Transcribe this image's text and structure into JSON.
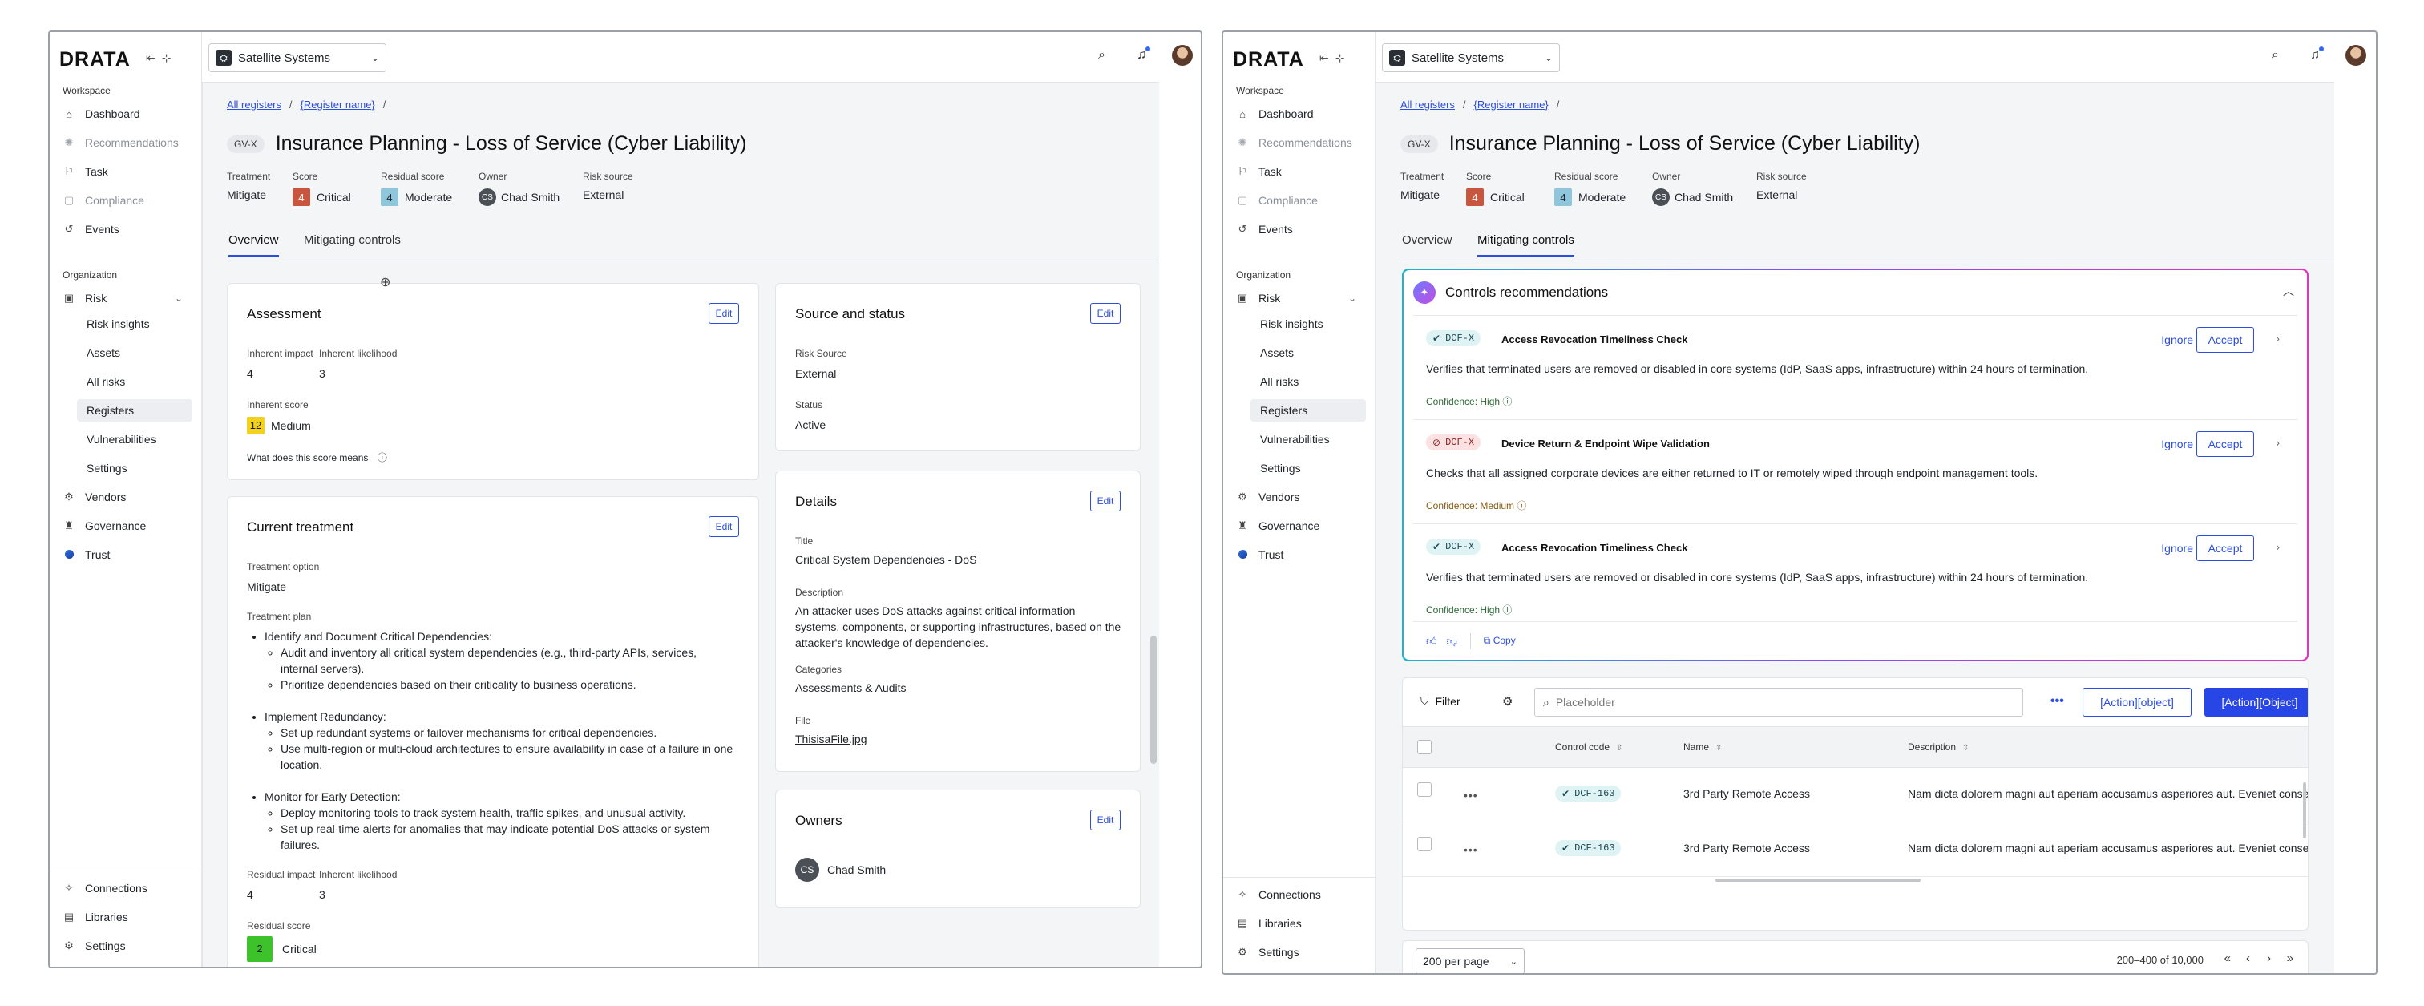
{
  "brand": {
    "logo": "DRATA"
  },
  "org": {
    "name": "Satellite Systems"
  },
  "sidebar": {
    "workspace_label": "Workspace",
    "organization_label": "Organization",
    "items": [
      {
        "label": "Dashboard",
        "icon": "home-icon"
      },
      {
        "label": "Recommendations",
        "icon": "sparkle-icon"
      },
      {
        "label": "Task",
        "icon": "flag-icon"
      },
      {
        "label": "Compliance",
        "icon": "shield-check-icon"
      },
      {
        "label": "Events",
        "icon": "history-icon"
      }
    ],
    "risk": {
      "label": "Risk",
      "icon": "risk-icon"
    },
    "risk_sub": [
      "Risk insights",
      "Assets",
      "All risks",
      "Registers",
      "Vulnerabilities",
      "Settings"
    ],
    "org_items": [
      {
        "label": "Vendors",
        "icon": "vendors-icon"
      },
      {
        "label": "Governance",
        "icon": "governance-icon"
      },
      {
        "label": "Trust",
        "icon": "trust-icon"
      }
    ],
    "bottom": [
      {
        "label": "Connections",
        "icon": "plug-icon"
      },
      {
        "label": "Libraries",
        "icon": "book-icon"
      },
      {
        "label": "Settings",
        "icon": "gear-icon"
      }
    ]
  },
  "page": {
    "breadcrumb": {
      "root": "All registers",
      "current": "{Register name}"
    },
    "code": "GV-X",
    "title": "Insurance Planning - Loss of Service (Cyber Liability)",
    "meta": {
      "treatment_label": "Treatment",
      "treatment": "Mitigate",
      "score_label": "Score",
      "score_num": "4",
      "score_text": "Critical",
      "residual_label": "Residual score",
      "residual_num": "4",
      "residual_text": "Moderate",
      "owner_label": "Owner",
      "owner_initials": "CS",
      "owner": "Chad Smith",
      "source_label": "Risk source",
      "source": "External"
    },
    "tabs": {
      "overview": "Overview",
      "mitigating": "Mitigating controls"
    },
    "edit_label": "Edit"
  },
  "assessment": {
    "title": "Assessment",
    "impact_label": "Inherent impact",
    "impact": "4",
    "likelihood_label": "Inherent likelihood",
    "likelihood": "3",
    "score_label": "Inherent score",
    "score_num": "12",
    "score_text": "Medium",
    "help": "What does this score means"
  },
  "treatment": {
    "title": "Current treatment",
    "option_label": "Treatment option",
    "option": "Mitigate",
    "plan_label": "Treatment plan",
    "plan": [
      {
        "head": "Identify and Document Critical Dependencies:",
        "subs": [
          "Audit and inventory all critical system dependencies (e.g., third-party APIs, services, internal servers).",
          "Prioritize dependencies based on their criticality to business operations."
        ]
      },
      {
        "head": "Implement Redundancy:",
        "subs": [
          "Set up redundant systems or failover mechanisms for critical dependencies.",
          "Use multi-region or multi-cloud architectures to ensure availability in case of a failure in one location."
        ]
      },
      {
        "head": "Monitor for Early Detection:",
        "subs": [
          "Deploy monitoring tools to track system health, traffic spikes, and unusual activity.",
          "Set up real-time alerts for anomalies that may indicate potential DoS attacks or system failures."
        ]
      }
    ],
    "res_impact_label": "Residual impact",
    "res_impact": "4",
    "res_likelihood_label": "Inherent likelihood",
    "res_likelihood": "3",
    "res_score_label": "Residual score",
    "res_score_num": "2",
    "res_score_text": "Critical"
  },
  "source_status": {
    "title": "Source and status",
    "source_label": "Risk Source",
    "source": "External",
    "status_label": "Status",
    "status": "Active"
  },
  "details": {
    "title": "Details",
    "title_label": "Title",
    "title_val": "Critical System Dependencies - DoS",
    "desc_label": "Description",
    "desc": "An attacker uses DoS attacks against critical information systems, components, or supporting infrastructures, based on the attacker's knowledge of dependencies.",
    "cat_label": "Categories",
    "categories": "Assessments & Audits",
    "file_label": "File",
    "file": "ThisisaFile.jpg"
  },
  "owners": {
    "title": "Owners",
    "initials": "CS",
    "name": "Chad Smith"
  },
  "reco": {
    "title": "Controls recommendations",
    "ignore": "Ignore",
    "accept": "Accept",
    "copy": "Copy",
    "items": [
      {
        "code": "DCF-X",
        "name": "Access Revocation Timeliness Check",
        "desc": "Verifies that terminated users are removed or disabled in core systems (IdP, SaaS apps, infrastructure) within 24 hours of termination.",
        "confidence": "Confidence: High",
        "status": "ok"
      },
      {
        "code": "DCF-X",
        "name": "Device Return & Endpoint Wipe Validation",
        "desc": "Checks that all assigned corporate devices are either returned to IT or remotely wiped through endpoint management tools.",
        "confidence": "Confidence: Medium",
        "status": "bad"
      },
      {
        "code": "DCF-X",
        "name": "Access Revocation Timeliness Check",
        "desc": "Verifies that terminated users are removed or disabled in core systems (IdP, SaaS apps, infrastructure) within 24 hours of termination.",
        "confidence": "Confidence: High",
        "status": "ok"
      }
    ]
  },
  "table": {
    "filter": "Filter",
    "search_placeholder": "Placeholder",
    "action1": "[Action][object]",
    "action2": "[Action][Object]",
    "headers": {
      "code": "Control code",
      "name": "Name",
      "description": "Description"
    },
    "rows": [
      {
        "code": "DCF-163",
        "name": "3rd Party Remote Access",
        "description": "Nam dicta dolorem magni aut aperiam accusamus asperiores aut. Eveniet conse..."
      },
      {
        "code": "DCF-163",
        "name": "3rd Party Remote Access",
        "description": "Nam dicta dolorem magni aut aperiam accusamus asperiores aut. Eveniet conse..."
      }
    ],
    "per_page": "200 per page",
    "range": "200–400 of 10,000"
  },
  "colors": {
    "accent": "#2c4ee0",
    "critical": "#c8553d",
    "moderate": "#8fc6dc",
    "medium": "#f2d21c",
    "residual_critical": "#3ec22b",
    "confidence_high": "#2d6a38",
    "confidence_medium": "#8a5a12"
  }
}
